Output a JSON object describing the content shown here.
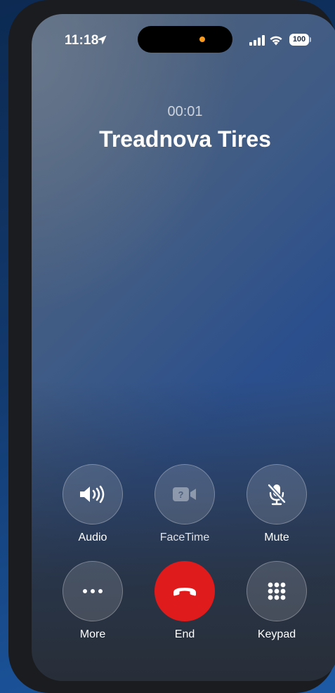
{
  "status_bar": {
    "time": "11:18",
    "battery": "100",
    "icons": [
      "location-arrow-icon",
      "signal-icon",
      "wifi-icon",
      "battery-icon"
    ],
    "island_indicator_color": "#f79a1e"
  },
  "call": {
    "duration": "00:01",
    "caller_name": "Treadnova Tires"
  },
  "controls": [
    {
      "label": "Audio",
      "icon": "speaker-icon",
      "enabled": true
    },
    {
      "label": "FaceTime",
      "icon": "facetime-video-icon",
      "enabled": false
    },
    {
      "label": "Mute",
      "icon": "mute-mic-icon",
      "enabled": true
    },
    {
      "label": "More",
      "icon": "ellipsis-icon",
      "enabled": true
    },
    {
      "label": "End",
      "icon": "end-call-icon",
      "enabled": true
    },
    {
      "label": "Keypad",
      "icon": "keypad-icon",
      "enabled": true
    }
  ],
  "colors": {
    "end_button": "#e01b1b",
    "button_fill": "rgba(255,255,255,0.14)",
    "background_blue": "#2b4f8c"
  }
}
